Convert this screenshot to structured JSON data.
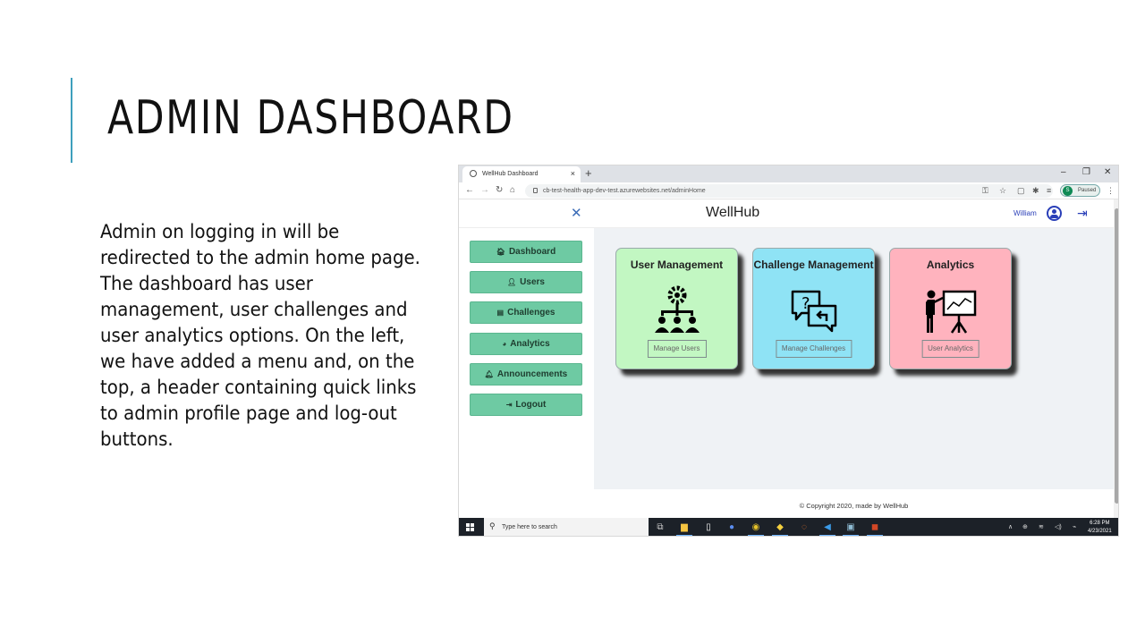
{
  "slide": {
    "title": "ADMIN DASHBOARD",
    "body": "Admin on logging in will be redirected to the admin home page. The dashboard has user management, user challenges and user analytics options. On the left, we have added a menu and, on the top, a header containing quick links to admin profile page and log-out buttons.",
    "accent_color": "#3e9fbd"
  },
  "browser": {
    "tab_title": "WellHub Dashboard",
    "tab_close": "×",
    "new_tab": "+",
    "url": "cb-test-health-app-dev-test.azurewebsites.net/adminHome",
    "profile_initial": "S",
    "profile_status": "Paused",
    "window_controls": [
      "–",
      "❐",
      "✕"
    ]
  },
  "app": {
    "brand": "WellHub",
    "user_name": "William",
    "menu_close_icon": "✕",
    "sidebar": [
      {
        "icon": "home-icon",
        "glyph": "🏠︎",
        "label": "Dashboard"
      },
      {
        "icon": "user-icon",
        "glyph": "👤︎",
        "label": "Users"
      },
      {
        "icon": "file-icon",
        "glyph": "▤",
        "label": "Challenges"
      },
      {
        "icon": "pie-chart-icon",
        "glyph": "◕",
        "label": "Analytics"
      },
      {
        "icon": "bell-icon",
        "glyph": "🔔︎",
        "label": "Announcements"
      },
      {
        "icon": "sign-out-icon",
        "glyph": "⇥",
        "label": "Logout"
      }
    ],
    "cards": [
      {
        "title": "User Management",
        "button": "Manage Users",
        "color": "#c2f7c2"
      },
      {
        "title": "Challenge Management",
        "button": "Manage Challenges",
        "color": "#8fe3f5"
      },
      {
        "title": "Analytics",
        "button": "User Analytics",
        "color": "#ffb3be"
      }
    ],
    "footer": "© Copyright 2020, made by WellHub"
  },
  "taskbar": {
    "search_placeholder": "Type here to search",
    "time": "6:28 PM",
    "date": "4/23/2021"
  }
}
